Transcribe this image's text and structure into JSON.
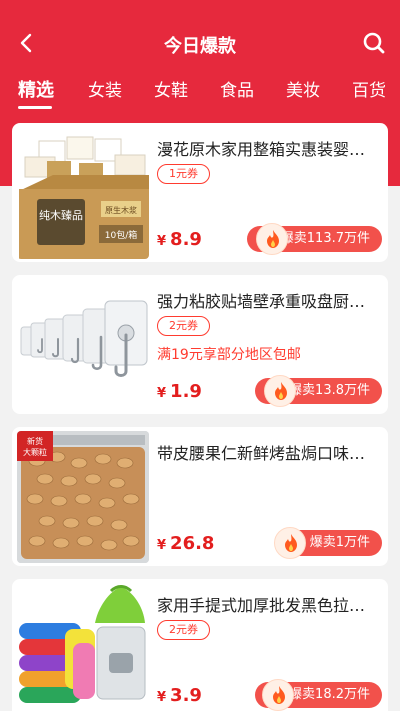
{
  "header": {
    "title": "今日爆款",
    "back_icon": "chevron-left-icon",
    "search_icon": "search-icon"
  },
  "tabs": [
    {
      "label": "精选",
      "active": true
    },
    {
      "label": "女装",
      "active": false
    },
    {
      "label": "女鞋",
      "active": false
    },
    {
      "label": "食品",
      "active": false
    },
    {
      "label": "美妆",
      "active": false
    },
    {
      "label": "百货",
      "active": false
    }
  ],
  "products": [
    {
      "name": "漫花原木家用整箱实惠装婴…",
      "coupon": "1元券",
      "currency": "¥",
      "price": "8.9",
      "sales": "爆卖113.7万件",
      "image_icon": "tissue-box-icon",
      "image_text": "纯木臻品",
      "image_sub": "10包/箱",
      "image_badge": "原生木浆"
    },
    {
      "name": "强力粘胶贴墙壁承重吸盘厨…",
      "coupon": "2元券",
      "promo": "满19元享部分地区包邮",
      "currency": "¥",
      "price": "1.9",
      "sales": "爆卖13.8万件",
      "image_icon": "wall-hooks-icon"
    },
    {
      "name": "带皮腰果仁新鲜烤盐焗口味…",
      "currency": "¥",
      "price": "26.8",
      "sales": "爆卖1万件",
      "image_icon": "cashew-nuts-icon",
      "image_badge": "新货 大颗粒"
    },
    {
      "name": "家用手提式加厚批发黑色拉…",
      "coupon": "2元券",
      "currency": "¥",
      "price": "3.9",
      "sales": "爆卖18.2万件",
      "image_icon": "garbage-bags-icon"
    }
  ],
  "colors": {
    "brand_red": "#e6293d",
    "price_red": "#e31e1e",
    "sales_pill": "#f2514b",
    "coupon_red": "#ff3b2f"
  }
}
